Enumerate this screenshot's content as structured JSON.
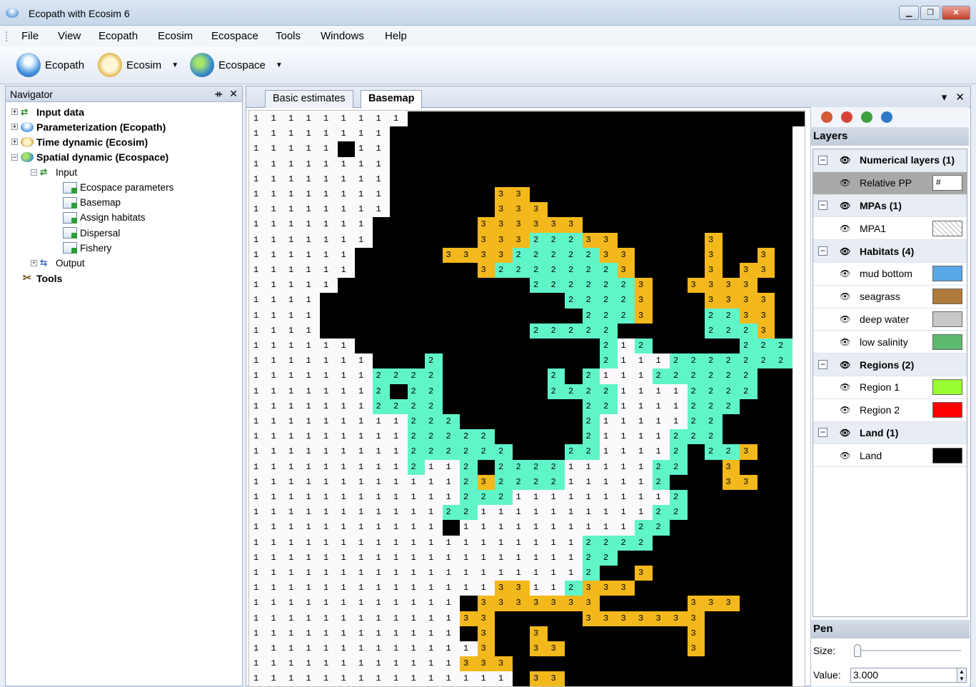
{
  "window": {
    "title": "Ecopath with Ecosim 6",
    "buttons": [
      "▁",
      "❐",
      "✕"
    ]
  },
  "menu": [
    "File",
    "View",
    "Ecopath",
    "Ecosim",
    "Ecospace",
    "Tools",
    "Windows",
    "Help"
  ],
  "toolbar": {
    "ecopath": "Ecopath",
    "ecosim": "Ecosim",
    "ecospace": "Ecospace"
  },
  "navigator": {
    "title": "Navigator",
    "pin": "ᚑ",
    "close": "✕",
    "nodes": {
      "input_data": "Input data",
      "parameterization": "Parameterization (Ecopath)",
      "time_dynamic": "Time dynamic (Ecosim)",
      "spatial_dynamic": "Spatial dynamic  (Ecospace)",
      "input": "Input",
      "ecospace_parameters": "Ecospace parameters",
      "basemap": "Basemap",
      "assign_habitats": "Assign habitats",
      "dispersal": "Dispersal",
      "fishery": "Fishery",
      "output": "Output",
      "tools": "Tools"
    }
  },
  "tabs": {
    "basic_estimates": "Basic estimates",
    "basemap": "Basemap"
  },
  "layers_panel": {
    "title": "Layers",
    "numerical": "Numerical layers (1)",
    "relative_pp": "Relative PP",
    "relative_pp_value": "#",
    "mpas": "MPAs (1)",
    "mpa1": "MPA1",
    "habitats": "Habitats (4)",
    "mud_bottom": "mud bottom",
    "seagrass": "seagrass",
    "deep_water": "deep water",
    "low_salinity": "low salinity",
    "regions": "Regions (2)",
    "region1": "Region 1",
    "region2": "Region 2",
    "land_group": "Land (1)",
    "land": "Land",
    "colors": {
      "mud_bottom": "#5aa7e8",
      "seagrass": "#b07a3a",
      "deep_water": "#c8c8c8",
      "low_salinity": "#5cba6e",
      "region1": "#99ff33",
      "region2": "#ff0000",
      "land": "#000000"
    }
  },
  "pen": {
    "title": "Pen",
    "size_label": "Size:",
    "value_label": "Value:",
    "value": "3.000"
  },
  "map": {
    "cols": 31,
    "rows": 38,
    "grid": [
      "11111111100000000000000000000000",
      "1111111100000000000000000000000",
      "1111101100000000000000000000000",
      "1111111100000000000000000000000",
      "1111111100000000000000000000000",
      "1111111100000033000000000000000",
      "1111111100000033300000000000000",
      "1111111000000333333000000000000",
      "1111111000000333222330000030000",
      "1111110000033332222233000030030",
      "1111110000000322222223000030330",
      "1111100000000000222222300333300",
      "1111000000000000002222300033330",
      "1111000000000000000222300022330",
      "1111000000000000222220000022230",
      "1111110000000000000021200000222",
      "1111111000200000000021112222222",
      "1111111222200000020211122222200",
      "1111111202200000022221111222200",
      "1111111222200000000221111222000",
      "1111111112220000000211111220000",
      "1111111112222200000211112220000",
      "1111111112222220002211112022300",
      "1111111112112022221111122003000",
      "1111111111112322221111120003300",
      "1111111111112221111111112000000",
      "1111111111122111111111122000000",
      "1111111111101111111111220000000",
      "1111111111111111111222200000000",
      "1111111111111111111220000000000",
      "1111111111111111111200300000000",
      "1111111111111133112333000000000",
      "1111111111110333333300000333000",
      "1111111111113300000333333300000",
      "1111111111110300300000000300000",
      "1111111111111300330000000300000",
      "1111111111113330000000000000000",
      "1111111111111110330000000000000",
      "1111111111111111133300000000000",
      "1111111111111111103333000000000"
    ]
  }
}
